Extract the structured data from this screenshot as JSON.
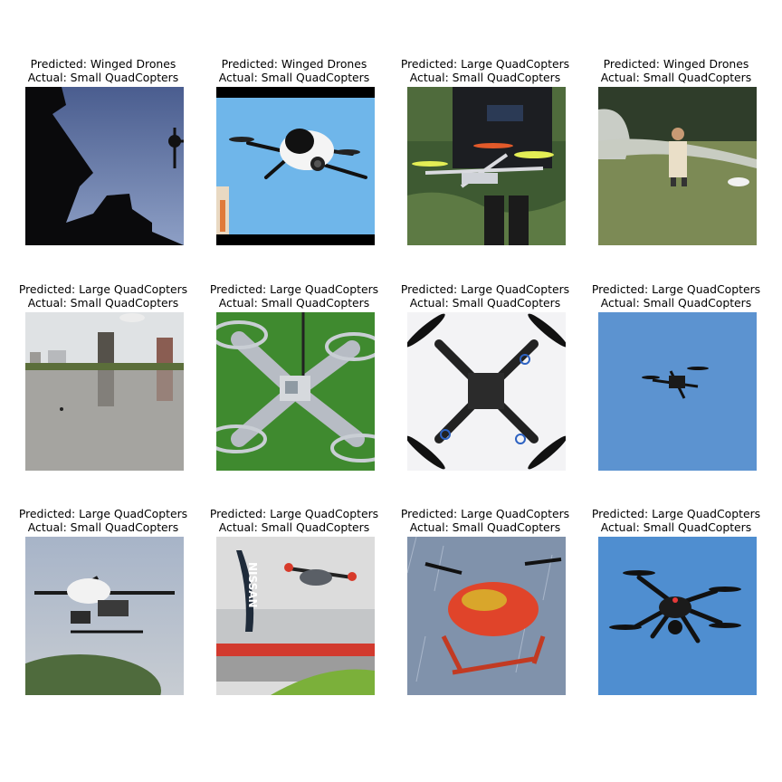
{
  "figure": {
    "panels": [
      {
        "predicted": "Predicted: Winged Drones",
        "actual": "Actual: Small QuadCopters"
      },
      {
        "predicted": "Predicted: Winged Drones",
        "actual": "Actual: Small QuadCopters"
      },
      {
        "predicted": "Predicted: Large QuadCopters",
        "actual": "Actual: Small QuadCopters"
      },
      {
        "predicted": "Predicted: Winged Drones",
        "actual": "Actual: Small QuadCopters"
      },
      {
        "predicted": "Predicted: Large QuadCopters",
        "actual": "Actual: Small QuadCopters"
      },
      {
        "predicted": "Predicted: Large QuadCopters",
        "actual": "Actual: Small QuadCopters"
      },
      {
        "predicted": "Predicted: Large QuadCopters",
        "actual": "Actual: Small QuadCopters"
      },
      {
        "predicted": "Predicted: Large QuadCopters",
        "actual": "Actual: Small QuadCopters"
      },
      {
        "predicted": "Predicted: Large QuadCopters",
        "actual": "Actual: Small QuadCopters"
      },
      {
        "predicted": "Predicted: Large QuadCopters",
        "actual": "Actual: Small QuadCopters"
      },
      {
        "predicted": "Predicted: Large QuadCopters",
        "actual": "Actual: Small QuadCopters"
      },
      {
        "predicted": "Predicted: Large QuadCopters",
        "actual": "Actual: Small QuadCopters"
      }
    ],
    "banner_text": "NISSAN"
  },
  "chart_data": {
    "type": "table",
    "columns": [
      "Predicted",
      "Actual"
    ],
    "rows": [
      [
        "Winged Drones",
        "Small QuadCopters"
      ],
      [
        "Winged Drones",
        "Small QuadCopters"
      ],
      [
        "Large QuadCopters",
        "Small QuadCopters"
      ],
      [
        "Winged Drones",
        "Small QuadCopters"
      ],
      [
        "Large QuadCopters",
        "Small QuadCopters"
      ],
      [
        "Large QuadCopters",
        "Small QuadCopters"
      ],
      [
        "Large QuadCopters",
        "Small QuadCopters"
      ],
      [
        "Large QuadCopters",
        "Small QuadCopters"
      ],
      [
        "Large QuadCopters",
        "Small QuadCopters"
      ],
      [
        "Large QuadCopters",
        "Small QuadCopters"
      ],
      [
        "Large QuadCopters",
        "Small QuadCopters"
      ],
      [
        "Large QuadCopters",
        "Small QuadCopters"
      ]
    ]
  }
}
